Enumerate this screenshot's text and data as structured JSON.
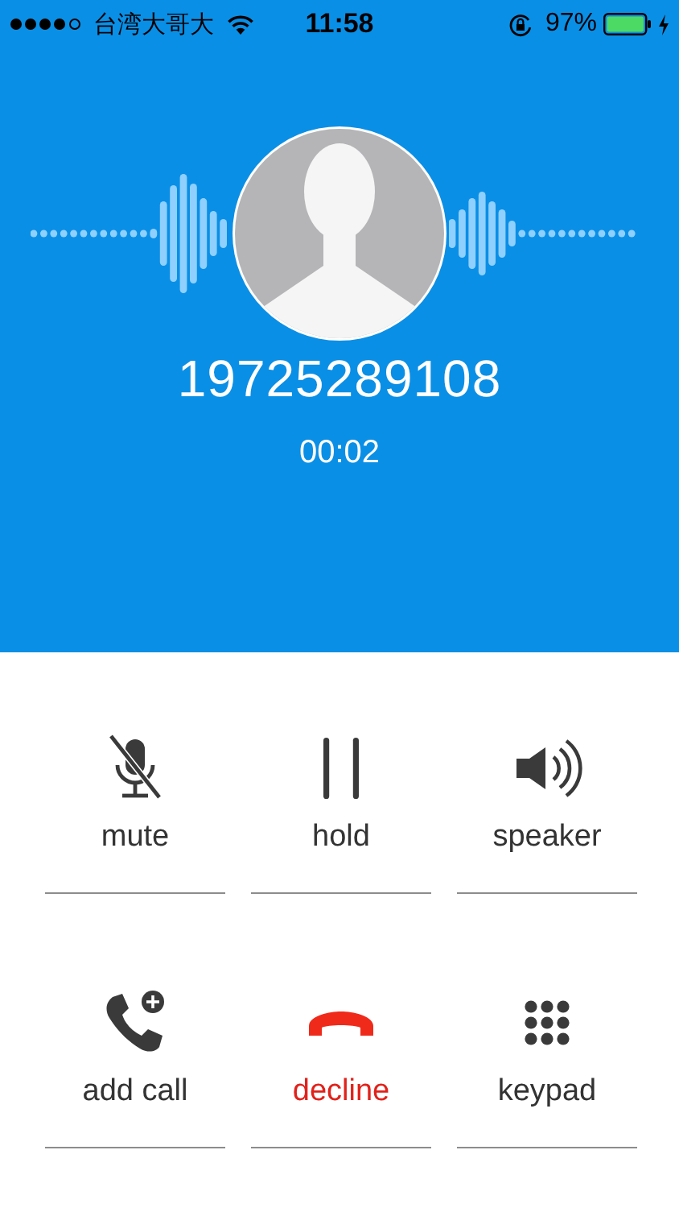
{
  "status_bar": {
    "carrier": "台湾大哥大",
    "time": "11:58",
    "battery": "97%"
  },
  "call": {
    "number": "19725289108",
    "duration": "00:02"
  },
  "buttons": [
    {
      "kind": "mute",
      "label": "mute"
    },
    {
      "kind": "hold",
      "label": "hold"
    },
    {
      "kind": "speaker",
      "label": "speaker"
    },
    {
      "kind": "add",
      "label": "add call"
    },
    {
      "kind": "decline",
      "label": "decline"
    },
    {
      "kind": "keypad",
      "label": "keypad"
    }
  ]
}
